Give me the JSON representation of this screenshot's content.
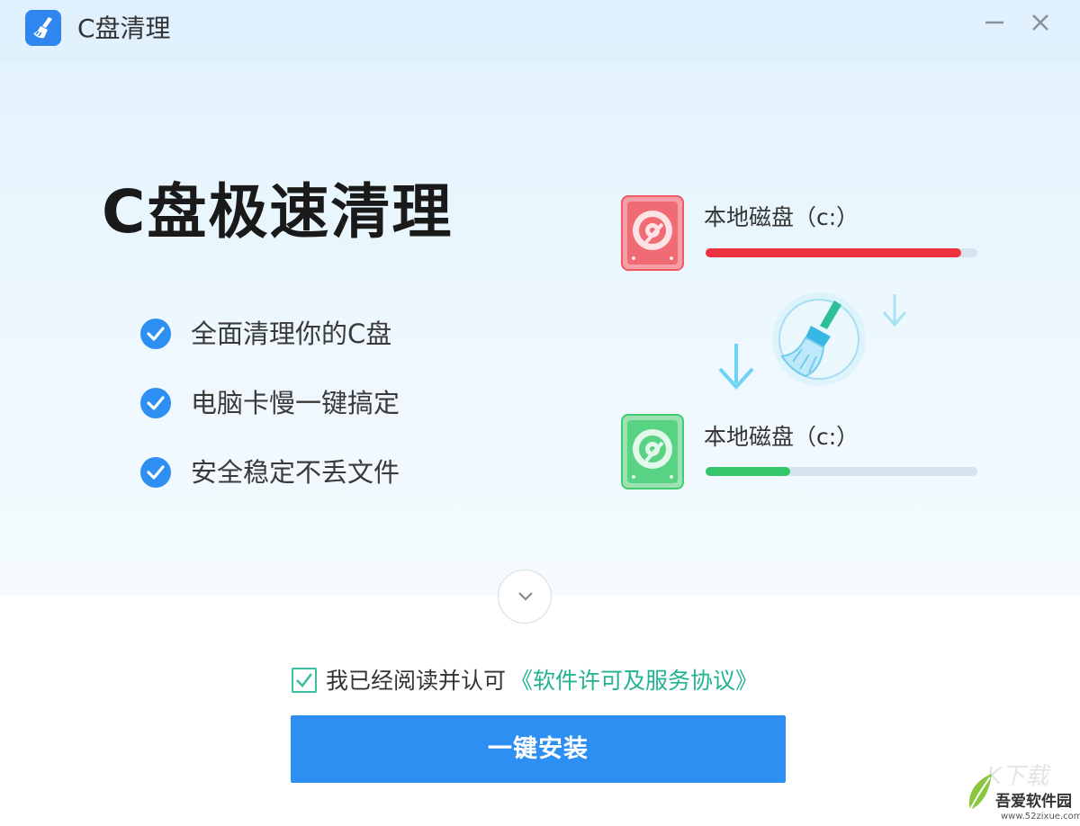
{
  "window": {
    "title": "C盘清理",
    "icon": "broom-icon",
    "controls": {
      "minimize": "minimize-icon",
      "close": "close-icon"
    }
  },
  "hero": {
    "headline": "C盘极速清理",
    "features": [
      {
        "text": "全面清理你的C盘",
        "icon": "check-circle-icon"
      },
      {
        "text": "电脑卡慢一键搞定",
        "icon": "check-circle-icon"
      },
      {
        "text": "安全稳定不丢文件",
        "icon": "check-circle-icon"
      }
    ]
  },
  "illustration": {
    "disk_before": {
      "label": "本地磁盘（c:）",
      "usage_fraction": 0.94,
      "color": "#ef3340",
      "icon": "hard-disk-icon"
    },
    "disk_after": {
      "label": "本地磁盘（c:）",
      "usage_fraction": 0.31,
      "color": "#33c76a",
      "icon": "hard-disk-icon"
    },
    "broom_icon": "broom-icon",
    "arrow_icon": "arrow-down-icon"
  },
  "footer": {
    "expand_icon": "chevron-down-icon",
    "agree_checked": true,
    "agree_text": "我已经阅读并认可",
    "agree_link": "《软件许可及服务协议》",
    "install_label": "一键安装"
  },
  "watermark": {
    "top": "K下载",
    "name": "吾爱软件园",
    "url": "www.52zixue.com"
  },
  "colors": {
    "accent": "#2d8ff2",
    "link": "#22b391",
    "check": "#2d8ff2"
  }
}
